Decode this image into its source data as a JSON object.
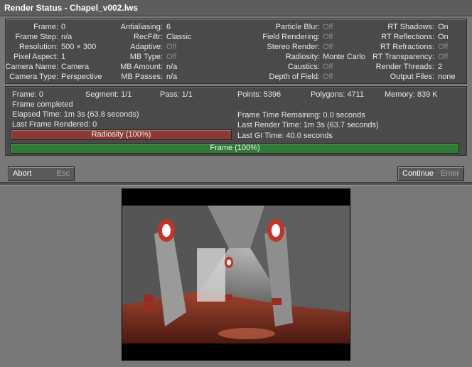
{
  "window": {
    "title": "Render Status - Chapel_v002.lws"
  },
  "settings": {
    "col1": [
      {
        "label": "Frame:",
        "value": "0"
      },
      {
        "label": "Frame Step:",
        "value": "n/a"
      },
      {
        "label": "Resolution:",
        "value": "500 × 300"
      },
      {
        "label": "Pixel Aspect:",
        "value": "1"
      },
      {
        "label": "Camera Name:",
        "value": "Camera"
      },
      {
        "label": "Camera Type:",
        "value": "Perspective"
      }
    ],
    "col2": [
      {
        "label": "Antialiasing:",
        "value": "6"
      },
      {
        "label": "RecFiltr:",
        "value": "Classic"
      },
      {
        "label": "Adaptive:",
        "value": "Off"
      },
      {
        "label": "MB Type:",
        "value": "Off"
      },
      {
        "label": "MB Amount:",
        "value": "n/a"
      },
      {
        "label": "MB Passes:",
        "value": "n/a"
      }
    ],
    "col3": [
      {
        "label": "Particle Blur:",
        "value": "Off"
      },
      {
        "label": "Field Rendering:",
        "value": "Off"
      },
      {
        "label": "Stereo Render:",
        "value": "Off"
      },
      {
        "label": "Radiosity:",
        "value": "Monte Carlo"
      },
      {
        "label": "Caustics:",
        "value": "Off"
      },
      {
        "label": "Depth of Field:",
        "value": "Off"
      }
    ],
    "col4": [
      {
        "label": "RT Shadows:",
        "value": "On"
      },
      {
        "label": "RT Reflections:",
        "value": "On"
      },
      {
        "label": "RT Refractions:",
        "value": "Off"
      },
      {
        "label": "RT Transparency:",
        "value": "Off"
      },
      {
        "label": "Render Threads:",
        "value": "2"
      },
      {
        "label": "Output Files:",
        "value": "none"
      }
    ]
  },
  "status": {
    "frame": "Frame: 0",
    "segment": "Segment: 1/1",
    "pass": "Pass: 1/1",
    "points": "Points: 5396",
    "polygons": "Polygons: 4711",
    "memory": "Memory: 839 K",
    "frame_completed": "Frame completed",
    "elapsed": "Elapsed Time: 1m 3s (63.8 seconds)",
    "last_frame": "Last Frame Rendered: 0",
    "remaining": "Frame Time Remaining: 0.0 seconds",
    "last_render": "Last Render Time: 1m 3s (63.7 seconds)",
    "last_gi": "Last GI Time: 40.0 seconds",
    "radiosity_bar_label": "Radiosity (100%)",
    "radiosity_progress": 1.0,
    "frame_bar_label": "Frame (100%)",
    "frame_progress": 1.0
  },
  "buttons": {
    "abort_label": "Abort",
    "abort_key": "Esc",
    "continue_label": "Continue",
    "continue_key": "Enter"
  },
  "colors": {
    "radiosity_bar": "#8a3b36",
    "frame_bar": "#2f7a35",
    "off_text": "#8a8a8a"
  }
}
